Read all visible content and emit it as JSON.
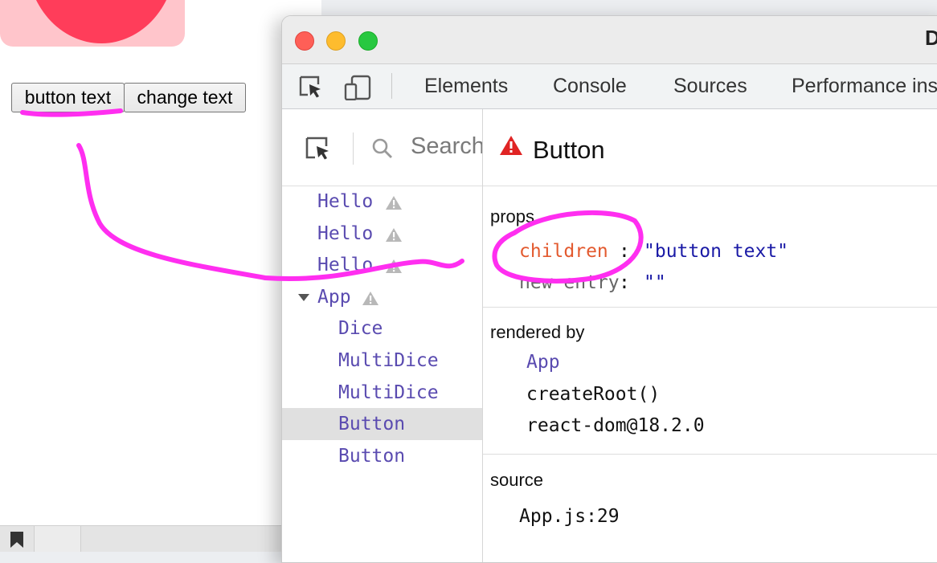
{
  "page": {
    "buttons": [
      {
        "label": "button text"
      },
      {
        "label": "change text"
      }
    ]
  },
  "devtools": {
    "window_title": "D",
    "tabs": [
      "Elements",
      "Console",
      "Sources",
      "Performance ins"
    ],
    "search_placeholder": "Search",
    "tree": [
      {
        "label": "Hello",
        "warning": true
      },
      {
        "label": "Hello",
        "warning": true
      },
      {
        "label": "Hello",
        "warning": true
      },
      {
        "label": "App",
        "warning": true,
        "expanded": true
      },
      {
        "label": "Dice"
      },
      {
        "label": "MultiDice"
      },
      {
        "label": "MultiDice"
      },
      {
        "label": "Button",
        "selected": true
      },
      {
        "label": "Button"
      }
    ],
    "details": {
      "title": "Button",
      "props_heading": "props",
      "props": [
        {
          "key": "children",
          "value": "\"button text\""
        },
        {
          "key": "new entry",
          "value": "\"\""
        }
      ],
      "rendered_by_heading": "rendered by",
      "rendered_by": [
        "App",
        "createRoot()",
        "react-dom@18.2.0"
      ],
      "source_heading": "source",
      "source": "App.js:29"
    }
  },
  "colors": {
    "annotation": "#ff2ef0",
    "component_purple": "#5a4bb0",
    "prop_key": "#e35a2f",
    "prop_value": "#1a1aa6",
    "warning_red": "#e02424"
  }
}
